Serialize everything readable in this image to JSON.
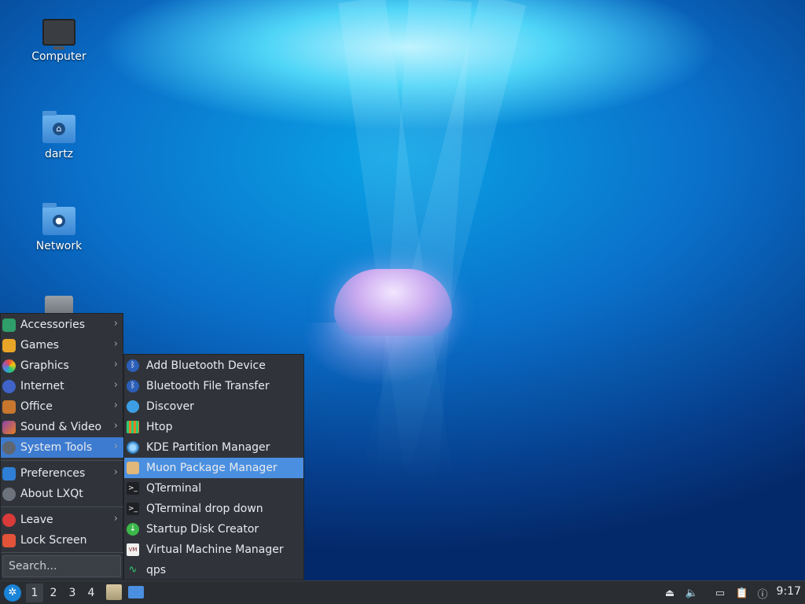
{
  "desktop": {
    "icons": [
      {
        "label": "Computer"
      },
      {
        "label": "dartz"
      },
      {
        "label": "Network"
      },
      {
        "label": ""
      }
    ]
  },
  "menu": {
    "items": [
      {
        "label": "Accessories",
        "icon": "accessories-icon",
        "has_submenu": true
      },
      {
        "label": "Games",
        "icon": "games-icon",
        "has_submenu": true
      },
      {
        "label": "Graphics",
        "icon": "graphics-icon",
        "has_submenu": true
      },
      {
        "label": "Internet",
        "icon": "internet-icon",
        "has_submenu": true
      },
      {
        "label": "Office",
        "icon": "office-icon",
        "has_submenu": true
      },
      {
        "label": "Sound & Video",
        "icon": "sound-video-icon",
        "has_submenu": true
      },
      {
        "label": "System Tools",
        "icon": "system-tools-icon",
        "has_submenu": true,
        "selected": true
      },
      {
        "label": "Preferences",
        "icon": "preferences-icon",
        "has_submenu": true
      },
      {
        "label": "About LXQt",
        "icon": "info-icon",
        "has_submenu": false
      },
      {
        "label": "Leave",
        "icon": "power-icon",
        "has_submenu": true
      },
      {
        "label": "Lock Screen",
        "icon": "lock-icon",
        "has_submenu": false
      }
    ],
    "search_placeholder": "Search..."
  },
  "submenu": {
    "title": "System Tools",
    "items": [
      {
        "label": "Add Bluetooth Device",
        "icon": "bluetooth-icon"
      },
      {
        "label": "Bluetooth File Transfer",
        "icon": "bluetooth-icon"
      },
      {
        "label": "Discover",
        "icon": "discover-icon"
      },
      {
        "label": "Htop",
        "icon": "htop-icon"
      },
      {
        "label": "KDE Partition Manager",
        "icon": "partition-manager-icon"
      },
      {
        "label": "Muon Package Manager",
        "icon": "package-icon",
        "selected": true
      },
      {
        "label": "QTerminal",
        "icon": "terminal-icon"
      },
      {
        "label": "QTerminal drop down",
        "icon": "terminal-icon"
      },
      {
        "label": "Startup Disk Creator",
        "icon": "startup-disk-icon"
      },
      {
        "label": "Virtual Machine Manager",
        "icon": "vm-manager-icon"
      },
      {
        "label": "qps",
        "icon": "qps-icon"
      }
    ]
  },
  "taskbar": {
    "workspaces": [
      "1",
      "2",
      "3",
      "4"
    ],
    "active_workspace": "1",
    "clock": "9:17"
  },
  "colors": {
    "menu_bg": "#30343a",
    "selection": "#3d7bd0",
    "submenu_selection": "#4a8fe0",
    "taskbar_bg": "#2a2d31"
  }
}
